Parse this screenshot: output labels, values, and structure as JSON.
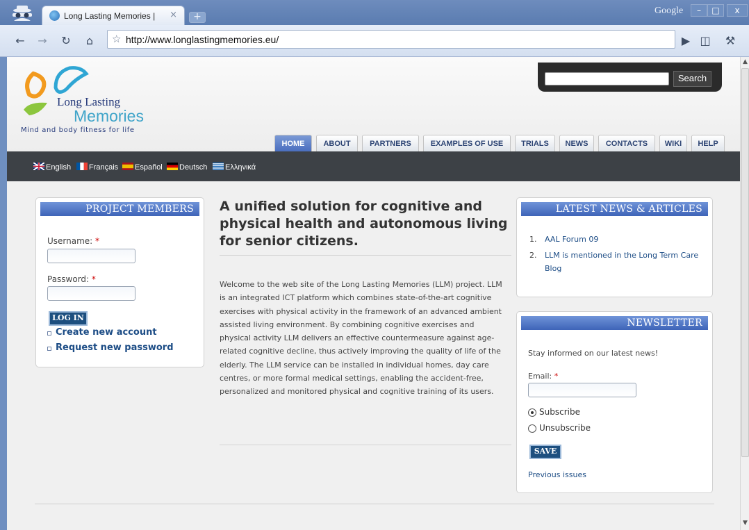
{
  "browser": {
    "tab_title": "Long Lasting Memories |",
    "tab_close": "×",
    "new_tab": "+",
    "search_engine_label": "Google",
    "url": "http://www.longlastingmemories.eu/",
    "window_controls": [
      "–",
      "□",
      "x"
    ]
  },
  "site": {
    "logo": {
      "name_line1": "Long Lasting",
      "name_line2": "Memories",
      "tagline": "Mind and body fitness for life"
    },
    "search": {
      "button": "Search",
      "placeholder": ""
    },
    "nav": [
      "HOME",
      "ABOUT",
      "PARTNERS",
      "EXAMPLES OF USE",
      "TRIALS",
      "NEWS",
      "CONTACTS",
      "WIKI",
      "HELP"
    ],
    "nav_active": "HOME",
    "languages": [
      {
        "label": "English",
        "colors": [
          "#012169",
          "#c8102e"
        ]
      },
      {
        "label": "Français",
        "colors": [
          "#0055a4",
          "#ef4135"
        ]
      },
      {
        "label": "Español",
        "colors": [
          "#aa151b",
          "#f1bf00"
        ]
      },
      {
        "label": "Deutsch",
        "colors": [
          "#000000",
          "#dd0000"
        ]
      },
      {
        "label": "Ελληνικά",
        "colors": [
          "#0d5eaf",
          "#ffffff"
        ]
      }
    ]
  },
  "login": {
    "title": "PROJECT MEMBERS",
    "username_label": "Username:",
    "password_label": "Password:",
    "required_mark": "*",
    "submit": "LOG IN",
    "links": [
      "Create new account",
      "Request new password"
    ]
  },
  "main": {
    "title": "A unified solution for cognitive and physical health and autonomous living for senior citizens.",
    "body": "Welcome to the web site of the Long Lasting Memories (LLM) project. LLM is an integrated ICT platform which combines state-of-the-art cognitive exercises with physical activity in the framework of an advanced ambient assisted living environment. By combining cognitive exercises and physical activity LLM delivers an effective countermeasure against age-related cognitive decline, thus actively improving the quality of life of the elderly. The LLM service can be installed in individual homes, day care centres, or more formal medical settings, enabling the accident-free, personalized and monitored physical and cognitive training of its users."
  },
  "news": {
    "title": "LATEST NEWS & ARTICLES",
    "items": [
      {
        "num": "1.",
        "text": "AAL Forum 09"
      },
      {
        "num": "2.",
        "text": "LLM is mentioned in the Long Term Care Blog"
      }
    ]
  },
  "newsletter": {
    "title": "NEWSLETTER",
    "intro": "Stay informed on our latest news!",
    "email_label": "Email:",
    "required_mark": "*",
    "options": [
      "Subscribe",
      "Unsubscribe"
    ],
    "selected": "Subscribe",
    "submit": "SAVE",
    "previous_link": "Previous issues"
  },
  "colors": {
    "nav_active": "#4a6ebf",
    "block_header": "#3e64b8",
    "link": "#1d4d86",
    "langbar": "#3d4146"
  }
}
